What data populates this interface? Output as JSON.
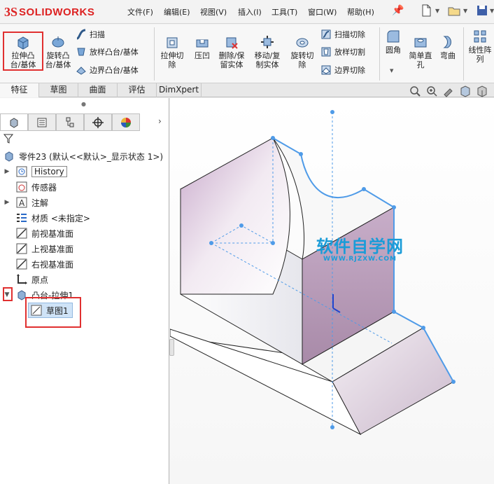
{
  "app": {
    "logo_prefix": "3S",
    "logo_name": "SOLIDWORKS"
  },
  "menu": [
    "文件(F)",
    "编辑(E)",
    "视图(V)",
    "插入(I)",
    "工具(T)",
    "窗口(W)",
    "帮助(H)"
  ],
  "ribbon": {
    "extrude_boss": "拉伸凸\n台/基体",
    "revolve_boss": "旋转凸\n台/基体",
    "sweep": "扫描",
    "loft_boss": "放样凸台/基体",
    "boundary_boss": "边界凸台/基体",
    "extrude_cut": "拉伸切\n除",
    "indent": "压凹",
    "delete_keep_body": "删除/保\n留实体",
    "move_copy_body": "移动/复\n制实体",
    "revolve_cut": "旋转切\n除",
    "swept_cut": "扫描切除",
    "lofted_cut": "放样切割",
    "boundary_cut": "边界切除",
    "fillet": "圆角",
    "simple_hole": "简单直\n孔",
    "flex": "弯曲",
    "linear_pattern": "线性阵\n列"
  },
  "tabs": [
    "特征",
    "草图",
    "曲面",
    "评估",
    "DimXpert"
  ],
  "tree": {
    "part": "零件23 (默认<<默认>_显示状态 1>)",
    "history": "History",
    "sensors": "传感器",
    "annotations": "注解",
    "material": "材质 <未指定>",
    "front_plane": "前视基准面",
    "top_plane": "上视基准面",
    "right_plane": "右视基准面",
    "origin": "原点",
    "boss_extrude": "凸台-拉伸1",
    "sketch": "草图1"
  },
  "watermark": {
    "title": "软件自学网",
    "url": "WWW.RJZXW.COM"
  },
  "colors": {
    "accent": "#1a9cd8",
    "highlight": "#e03030",
    "selection_blue": "#4f9be8",
    "face_purple": "#b79ab9"
  }
}
